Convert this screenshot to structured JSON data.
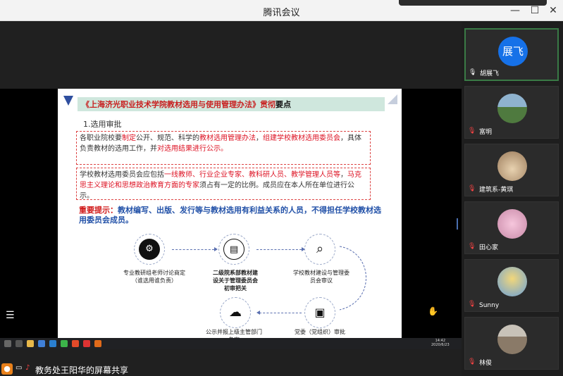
{
  "window": {
    "title": "腾讯会议",
    "minimize": "—",
    "maximize": "☐",
    "close": "✕"
  },
  "slide": {
    "title": "《上海济光职业技术学院教材选用与使用管理办法》贯彻",
    "title_tail": "要点",
    "subhead": "1.选用审批",
    "box1": {
      "p1_a": "各职业院校要",
      "p1_b": "制定",
      "p1_c": "公开、规范、科学的",
      "p1_d": "教材选用管理办法",
      "p1_e": "，",
      "p1_f": "组建学校教材选用委员会",
      "p1_g": "，具体负责教材的选用工作，并",
      "p1_h": "对选用结果进行公示。"
    },
    "box2": {
      "a": "学校教材选用委员会应包括",
      "b": "一线教师、行业企业专家、教科研人员、教学管理人员等",
      "c": "，",
      "d": "马克思主义理论和思想政治教育方面的专家",
      "e": "须占有一定的比例。成员应在本人所在单位进行公示。"
    },
    "notice_label": "重要提示：",
    "notice_text": "教材编写、出版、发行等与教材选用有利益关系的人员，不得担任学校教材选用委员会成员。",
    "steps": [
      {
        "icon": "head-gear-icon",
        "glyph": "⚙",
        "caption": "专业教研组老师讨论商定（谁选用谁负责）"
      },
      {
        "icon": "presentation-icon",
        "glyph": "▤",
        "caption": "二级院系部教材建设关于管理委员会初审把关"
      },
      {
        "icon": "magnifier-icon",
        "glyph": "⌕",
        "caption": "学校教材建设与管理委员会审议"
      },
      {
        "icon": "lock-icon",
        "glyph": "▣",
        "caption": "党委（党组织）审批"
      },
      {
        "icon": "cloud-upload-icon",
        "glyph": "☁",
        "caption": "公示并报上级主管部门备案"
      }
    ]
  },
  "taskbar": {
    "time": "14:42",
    "date": "2020/6/23"
  },
  "participants": [
    {
      "name": "胡展飞",
      "avatar_text": "展飞",
      "avatar_color": "#1671e8",
      "active": true
    },
    {
      "name": "富明",
      "avatar_color": "#5d8a57"
    },
    {
      "name": "建筑系-黄琪",
      "avatar_color": "#b79a7a"
    },
    {
      "name": "田心家",
      "avatar_color": "#e6a6c6"
    },
    {
      "name": "Sunny",
      "avatar_color": "#e8c96a"
    },
    {
      "name": "林俊",
      "avatar_color": "#a99a8a"
    }
  ],
  "share": {
    "text": "教务处王阳华的屏幕共享"
  }
}
